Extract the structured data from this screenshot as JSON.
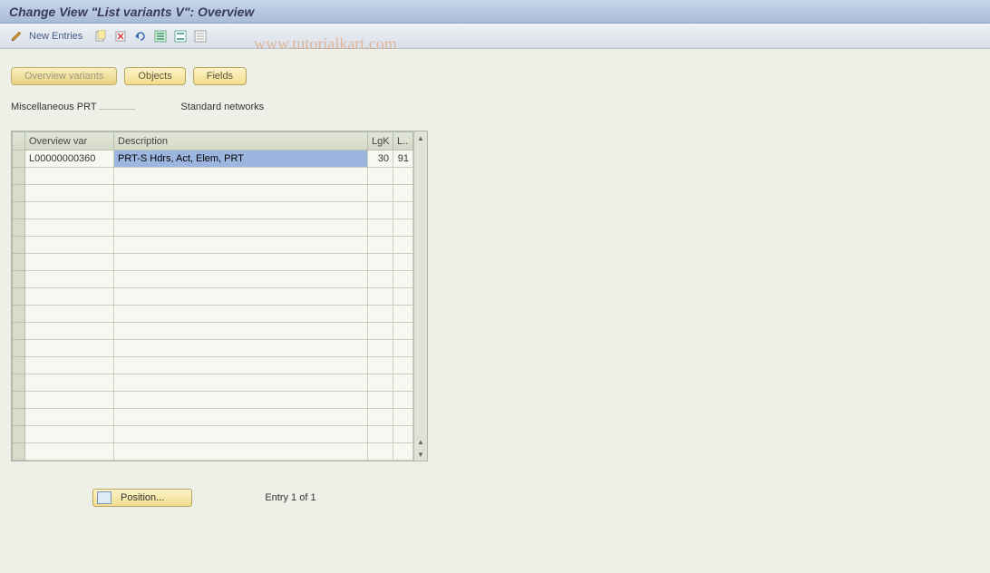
{
  "title": "Change View \"List variants                      V\": Overview",
  "toolbar": {
    "new_entries_label": "New Entries"
  },
  "watermark": "www.tutorialkart.com",
  "view_buttons": {
    "overview": "Overview variants",
    "objects": "Objects",
    "fields": "Fields"
  },
  "subheader": {
    "label1": "Miscellaneous PRT",
    "value1": "",
    "label2": "Standard networks"
  },
  "grid": {
    "headers": {
      "overview_var": "Overview var",
      "description": "Description",
      "lgk": "LgK",
      "l": "L.."
    },
    "rows": [
      {
        "ov": "L00000000360",
        "desc": "PRT-S Hdrs, Act, Elem, PRT",
        "lgk": "30",
        "l": "91"
      }
    ],
    "empty_row_count": 17
  },
  "footer": {
    "position_label": "Position...",
    "entry_label": "Entry 1 of 1"
  }
}
